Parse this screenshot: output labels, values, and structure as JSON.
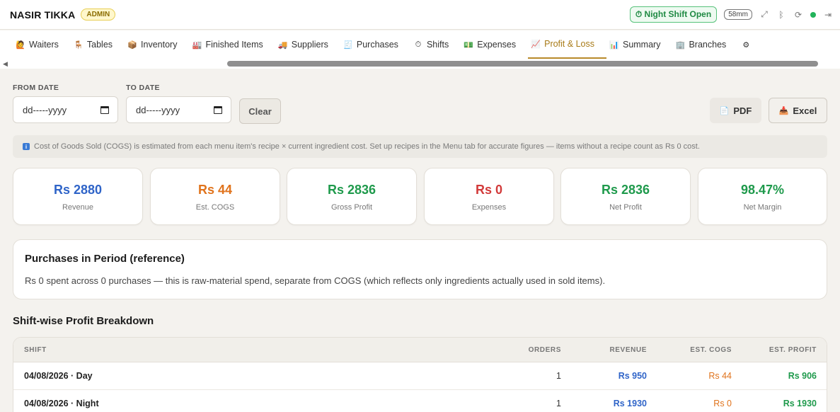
{
  "header": {
    "brand": "NASIR TIKKA",
    "role": "ADMIN",
    "shift_status": "⏱ Night Shift Open",
    "paper_size": "58mm"
  },
  "tabs": [
    {
      "icon": "🙋",
      "label": "Waiters"
    },
    {
      "icon": "🪑",
      "label": "Tables"
    },
    {
      "icon": "📦",
      "label": "Inventory"
    },
    {
      "icon": "🏭",
      "label": "Finished Items"
    },
    {
      "icon": "🚚",
      "label": "Suppliers"
    },
    {
      "icon": "🧾",
      "label": "Purchases"
    },
    {
      "icon": "⏱",
      "label": "Shifts"
    },
    {
      "icon": "💵",
      "label": "Expenses"
    },
    {
      "icon": "📈",
      "label": "Profit & Loss"
    },
    {
      "icon": "📊",
      "label": "Summary"
    },
    {
      "icon": "🏢",
      "label": "Branches"
    },
    {
      "icon": "⚙",
      "label": ""
    }
  ],
  "active_tab": "Profit & Loss",
  "filters": {
    "from_label": "FROM DATE",
    "to_label": "TO DATE",
    "from_value": "dd-----yyyy",
    "to_value": "dd-----yyyy",
    "clear_label": "Clear"
  },
  "export": {
    "pdf_label": "PDF",
    "excel_label": "Excel"
  },
  "info_note": "Cost of Goods Sold (COGS) is estimated from each menu item's recipe × current ingredient cost. Set up recipes in the Menu tab for accurate figures — items without a recipe count as Rs 0 cost.",
  "cards": [
    {
      "value": "Rs 2880",
      "label": "Revenue",
      "color": "#2f64c8"
    },
    {
      "value": "Rs 44",
      "label": "Est. COGS",
      "color": "#e0731c"
    },
    {
      "value": "Rs 2836",
      "label": "Gross Profit",
      "color": "#1f9a4c"
    },
    {
      "value": "Rs 0",
      "label": "Expenses",
      "color": "#d23a3a"
    },
    {
      "value": "Rs 2836",
      "label": "Net Profit",
      "color": "#1f9a4c"
    },
    {
      "value": "98.47%",
      "label": "Net Margin",
      "color": "#1f9a4c"
    }
  ],
  "purchases": {
    "title": "Purchases in Period (reference)",
    "text": "Rs 0 spent across 0 purchases — this is raw-material spend, separate from COGS (which reflects only ingredients actually used in sold items)."
  },
  "shift_breakdown": {
    "title": "Shift-wise Profit Breakdown",
    "columns": {
      "shift": "SHIFT",
      "orders": "ORDERS",
      "revenue": "REVENUE",
      "cogs": "EST. COGS",
      "profit": "EST. PROFIT"
    },
    "rows": [
      {
        "shift": "04/08/2026 · Day",
        "orders": "1",
        "revenue": "Rs 950",
        "cogs": "Rs 44",
        "profit": "Rs 906"
      },
      {
        "shift": "04/08/2026 · Night",
        "orders": "1",
        "revenue": "Rs 1930",
        "cogs": "Rs 0",
        "profit": "Rs 1930"
      }
    ]
  }
}
